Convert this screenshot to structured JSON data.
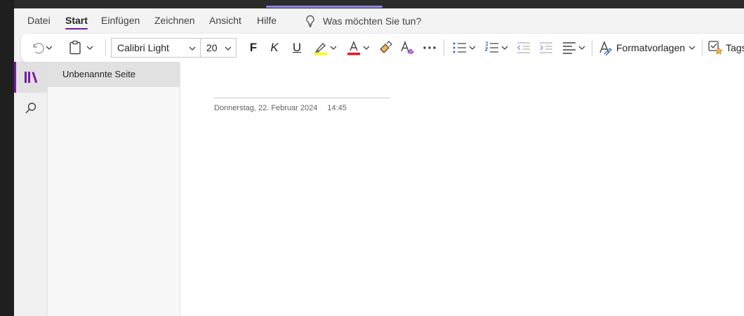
{
  "menu": {
    "tabs": [
      {
        "label": "Datei"
      },
      {
        "label": "Start"
      },
      {
        "label": "Einfügen"
      },
      {
        "label": "Zeichnen"
      },
      {
        "label": "Ansicht"
      },
      {
        "label": "Hilfe"
      }
    ],
    "active_tab": "Start",
    "search_placeholder": "Was möchten Sie tun?"
  },
  "toolbar": {
    "font_name": "Calibri Light",
    "font_size": "20",
    "bold_label": "F",
    "italic_label": "K",
    "underline_label": "U",
    "styles_label": "Formatvorlagen",
    "tags_label": "Tags"
  },
  "sidebar": {
    "pages": [
      {
        "title": "Unbenannte Seite"
      }
    ]
  },
  "page": {
    "date": "Donnerstag, 22. Februar 2024",
    "time": "14:45"
  },
  "colors": {
    "accent": "#7719aa",
    "highlight": "#ffff00",
    "font_color": "#e81123"
  },
  "icons": [
    "undo-icon",
    "clipboard-icon",
    "highlighter-icon",
    "font-color-icon",
    "format-painter-icon",
    "clear-formatting-icon",
    "more-icon",
    "bullets-icon",
    "numbering-icon",
    "decrease-indent-icon",
    "increase-indent-icon",
    "align-icon",
    "styles-icon",
    "tags-icon",
    "notebooks-icon",
    "search-icon",
    "lightbulb-icon"
  ]
}
